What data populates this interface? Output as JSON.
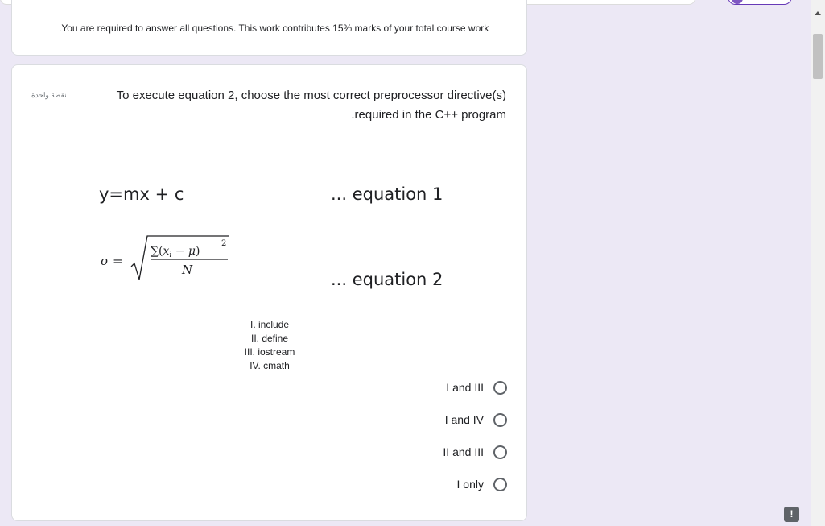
{
  "info": {
    "text": ".You are required to answer all questions. This work contributes 15% marks of your total course work"
  },
  "question": {
    "points": "نقطة واحدة",
    "title": "To execute equation 2, choose the most correct preprocessor directive(s) .required in the C++ program",
    "equation1": "y=mx + c",
    "equation1_label": "... equation 1",
    "equation2_label": "... equation 2",
    "list": [
      "I. include",
      "II. define",
      "III. iostream",
      "IV. cmath"
    ],
    "options": [
      "I and III",
      "I and IV",
      "II and III",
      "I only"
    ]
  },
  "icons": {
    "scroll_up": "triangle-up-icon",
    "feedback": "report-problem-icon"
  },
  "colors": {
    "page_bg": "#ece8f5",
    "card_bg": "#ffffff",
    "text": "#202124",
    "radio_border": "#5f6368"
  }
}
